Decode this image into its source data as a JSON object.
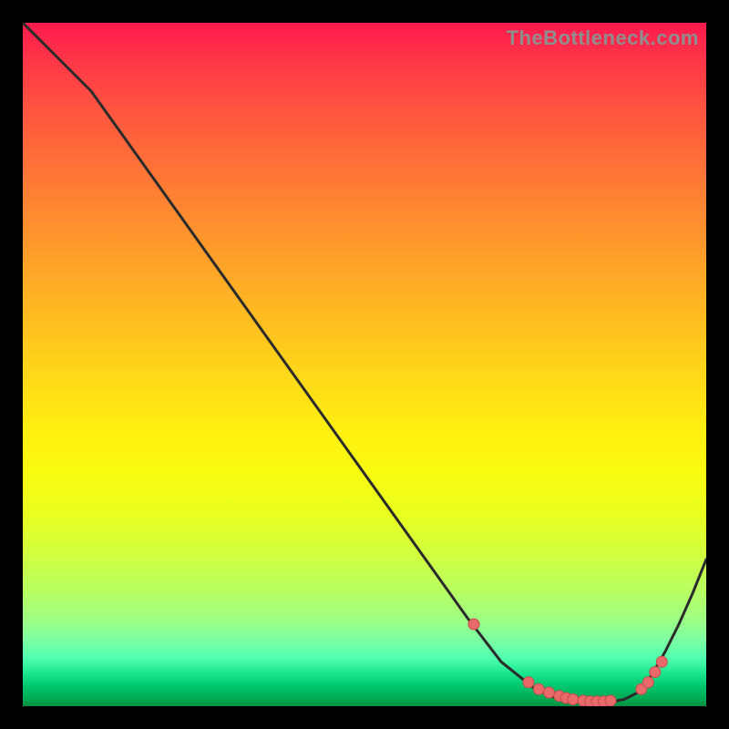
{
  "watermark": "TheBottleneck.com",
  "colors": {
    "frame": "#000000",
    "curve_stroke": "#2b2b2b",
    "dot_fill": "#e96a6a",
    "dot_stroke": "#c94a4a"
  },
  "chart_data": {
    "type": "line",
    "title": "",
    "xlabel": "",
    "ylabel": "",
    "xlim": [
      0,
      100
    ],
    "ylim": [
      0,
      100
    ],
    "series": [
      {
        "name": "bottleneck-curve",
        "x": [
          0,
          10,
          20,
          30,
          40,
          50,
          60,
          65,
          70,
          75,
          78,
          80,
          82,
          84,
          86,
          88,
          90,
          92,
          94,
          96,
          98,
          100
        ],
        "y": [
          100,
          90,
          76,
          62,
          48,
          34,
          20,
          13,
          6.5,
          2.5,
          1.2,
          0.8,
          0.6,
          0.5,
          0.6,
          1.0,
          2.0,
          4.5,
          8.0,
          12.0,
          16.5,
          21.5
        ]
      }
    ],
    "markers": {
      "name": "highlighted-points",
      "x": [
        66,
        74,
        75.5,
        77,
        78.5,
        79.5,
        80.5,
        82,
        83,
        84,
        85,
        86,
        90.5,
        91.5,
        92.5,
        93.5
      ],
      "y": [
        12,
        3.5,
        2.5,
        2.0,
        1.5,
        1.2,
        1.0,
        0.8,
        0.7,
        0.7,
        0.7,
        0.8,
        2.5,
        3.5,
        5.0,
        6.5
      ]
    }
  }
}
